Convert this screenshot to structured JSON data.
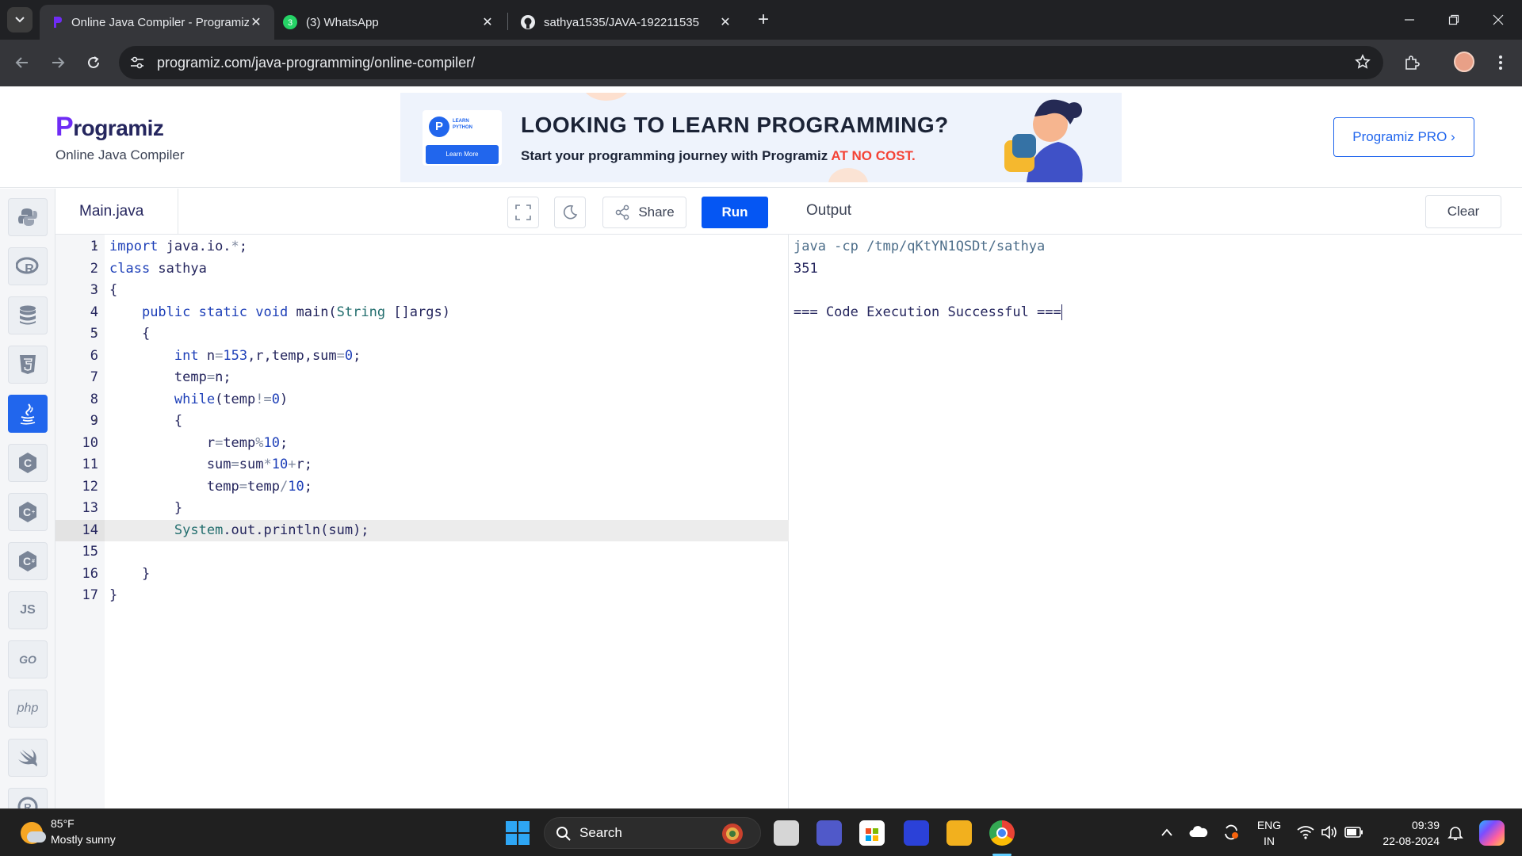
{
  "browser": {
    "tabs": [
      {
        "title": "Online Java Compiler - Programiz",
        "active": true
      },
      {
        "title": "(3) WhatsApp",
        "active": false
      },
      {
        "title": "sathya1535/JAVA-192211535",
        "active": false
      }
    ],
    "url": "programiz.com/java-programming/online-compiler/",
    "whatsapp_badge": "3"
  },
  "header": {
    "logo": "rogramiz",
    "logo_letter": "P",
    "subtitle": "Online Java Compiler",
    "pro_button": "Programiz PRO ›"
  },
  "ad": {
    "card_badge": "P",
    "card_text_1": "LEARN",
    "card_text_2": "PYTHON",
    "card_button": "Learn More",
    "headline": "LOOKING TO LEARN PROGRAMMING?",
    "sub": "Start your programming journey with Programiz ",
    "sub_highlight": "AT NO COST."
  },
  "sidebar": {
    "items": [
      {
        "icon": "python-icon",
        "label": ""
      },
      {
        "icon": "r-icon",
        "label": ""
      },
      {
        "icon": "database-icon",
        "label": ""
      },
      {
        "icon": "html5-icon",
        "label": ""
      },
      {
        "icon": "java-icon",
        "label": "",
        "active": true
      },
      {
        "icon": "c-icon",
        "label": ""
      },
      {
        "icon": "cpp-icon",
        "label": ""
      },
      {
        "icon": "csharp-icon",
        "label": ""
      },
      {
        "icon": "js-icon",
        "label": "JS"
      },
      {
        "icon": "go-icon",
        "label": "GO"
      },
      {
        "icon": "php-icon",
        "label": "php"
      },
      {
        "icon": "swift-icon",
        "label": ""
      },
      {
        "icon": "rust-icon",
        "label": ""
      }
    ]
  },
  "editor": {
    "filename": "Main.java",
    "share_label": "Share",
    "run_label": "Run",
    "active_line": 14,
    "lines": [
      {
        "n": "1",
        "fold": true
      },
      {
        "n": "2",
        "fold": false
      },
      {
        "n": "3",
        "fold": true
      },
      {
        "n": "4",
        "fold": false
      },
      {
        "n": "5",
        "fold": true
      },
      {
        "n": "6",
        "fold": false
      },
      {
        "n": "7",
        "fold": false
      },
      {
        "n": "8",
        "fold": false
      },
      {
        "n": "9",
        "fold": true
      },
      {
        "n": "10",
        "fold": false
      },
      {
        "n": "11",
        "fold": false
      },
      {
        "n": "12",
        "fold": false
      },
      {
        "n": "13",
        "fold": false
      },
      {
        "n": "14",
        "fold": false
      },
      {
        "n": "15",
        "fold": false
      },
      {
        "n": "16",
        "fold": false
      },
      {
        "n": "17",
        "fold": false
      }
    ],
    "code": [
      "import java.io.*;",
      "class sathya",
      "{",
      "    public static void main(String []args)",
      "    {",
      "        int n=153,r,temp,sum=0;",
      "        temp=n;",
      "        while(temp!=0)",
      "        {",
      "            r=temp%10;",
      "            sum=sum*10+r;",
      "            temp=temp/10;",
      "        }",
      "        System.out.println(sum);",
      "",
      "    }",
      "}"
    ]
  },
  "output": {
    "title": "Output",
    "clear_label": "Clear",
    "lines": [
      "java -cp /tmp/qKtYN1QSDt/sathya",
      "351",
      "",
      "=== Code Execution Successful ==="
    ]
  },
  "taskbar": {
    "weather_temp": "85°F",
    "weather_desc": "Mostly sunny",
    "search_label": "Search",
    "lang_1": "ENG",
    "lang_2": "IN",
    "time": "09:39",
    "date": "22-08-2024"
  }
}
